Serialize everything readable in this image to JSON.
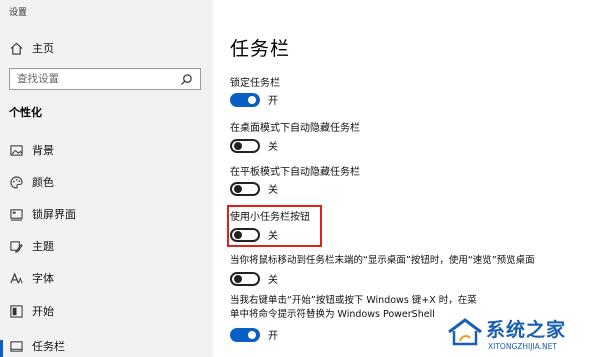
{
  "window": {
    "title": "设置"
  },
  "sidebar": {
    "home_label": "主页",
    "search_placeholder": "查找设置",
    "section": "个性化",
    "items": [
      {
        "label": "背景",
        "icon": "image-icon"
      },
      {
        "label": "颜色",
        "icon": "palette-icon"
      },
      {
        "label": "锁屏界面",
        "icon": "lock-screen-icon"
      },
      {
        "label": "主题",
        "icon": "theme-icon"
      },
      {
        "label": "字体",
        "icon": "font-icon"
      },
      {
        "label": "开始",
        "icon": "start-icon"
      },
      {
        "label": "任务栏",
        "icon": "taskbar-icon"
      }
    ],
    "accent_color": "#0a5fc4"
  },
  "main": {
    "title": "任务栏",
    "settings": [
      {
        "label": "锁定任务栏",
        "state": "开",
        "on": true
      },
      {
        "label": "在桌面模式下自动隐藏任务栏",
        "state": "关",
        "on": false
      },
      {
        "label": "在平板模式下自动隐藏任务栏",
        "state": "关",
        "on": false
      },
      {
        "label": "使用小任务栏按钮",
        "state": "关",
        "on": false
      },
      {
        "label": "当你将鼠标移动到任务栏末端的“显示桌面”按钮时，使用“速览”预览桌面",
        "state": "关",
        "on": false
      },
      {
        "label": "当我右键单击“开始”按钮或按下 Windows 键+X 时，在菜单中将命令提示符替换为 Windows PowerShell",
        "state": "开",
        "on": true
      }
    ],
    "highlight_color": "#e0201b"
  },
  "watermark": {
    "text": "系统之家",
    "url": "XITONGZHIJIA.NET"
  }
}
